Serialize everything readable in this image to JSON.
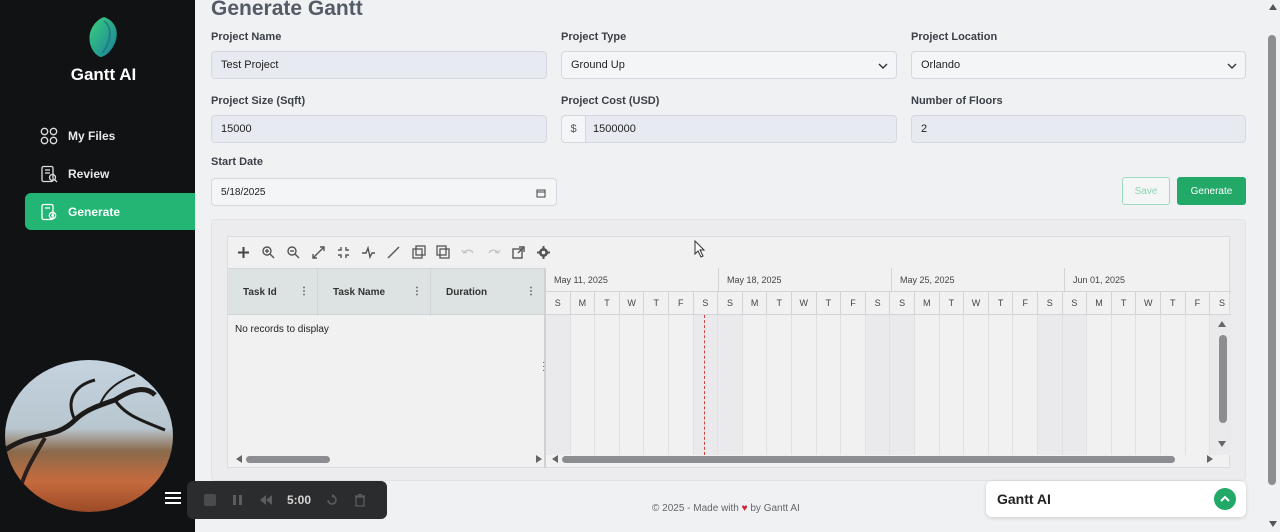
{
  "sidebar": {
    "brand": "Gantt AI",
    "items": [
      {
        "label": "My Files",
        "icon": "grid-icon",
        "active": false
      },
      {
        "label": "Review",
        "icon": "review-doc-icon",
        "active": true
      },
      {
        "label": "Generate",
        "icon": "generate-doc-icon",
        "active": true
      }
    ],
    "accent": "#22b573"
  },
  "media": {
    "time": "5:00"
  },
  "page": {
    "title": "Generate Gantt"
  },
  "form": {
    "project_name": {
      "label": "Project Name",
      "value": "Test Project"
    },
    "project_type": {
      "label": "Project Type",
      "value": "Ground Up"
    },
    "project_location": {
      "label": "Project Location",
      "value": "Orlando"
    },
    "project_size": {
      "label": "Project Size (Sqft)",
      "value": "15000"
    },
    "project_cost": {
      "label": "Project Cost (USD)",
      "prefix": "$",
      "value": "1500000"
    },
    "floors": {
      "label": "Number of Floors",
      "value": "2"
    },
    "start_date": {
      "label": "Start Date",
      "value": "5/18/2025"
    }
  },
  "actions": {
    "save": "Save",
    "generate": "Generate"
  },
  "gantt": {
    "columns": [
      "Task Id",
      "Task Name",
      "Duration"
    ],
    "empty_text": "No records to display",
    "weeks": [
      "May 11, 2025",
      "May 18, 2025",
      "May 25, 2025",
      "Jun 01, 2025"
    ],
    "days": [
      "S",
      "M",
      "T",
      "W",
      "T",
      "F",
      "S",
      "S",
      "M",
      "T",
      "W",
      "T",
      "F",
      "S",
      "S",
      "M",
      "T",
      "W",
      "T",
      "F",
      "S",
      "S",
      "M",
      "T",
      "W",
      "T",
      "F",
      "S"
    ]
  },
  "footer": {
    "prefix": "© 2025 - Made with",
    "heart": "♥",
    "suffix": "by Gantt AI"
  },
  "chat": {
    "title": "Gantt AI"
  }
}
